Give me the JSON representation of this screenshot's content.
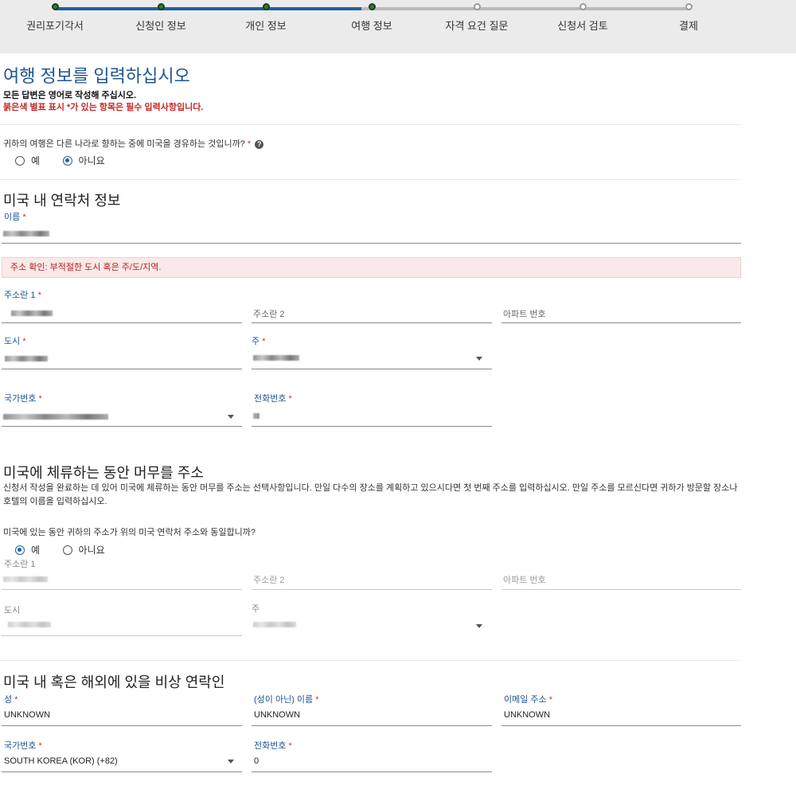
{
  "steps": [
    {
      "label": "권리포기각서",
      "status": "done"
    },
    {
      "label": "신청인 정보",
      "status": "done"
    },
    {
      "label": "개인 정보",
      "status": "done"
    },
    {
      "label": "여행 정보",
      "status": "current"
    },
    {
      "label": "자격 요건 질문",
      "status": "todo"
    },
    {
      "label": "신청서 검토",
      "status": "todo"
    },
    {
      "label": "결제",
      "status": "todo"
    }
  ],
  "page": {
    "title": "여행 정보를 입력하십시오",
    "note_english": "모든 답변은 영어로 작성해 주십시오.",
    "note_required": "붉은색 별표 표시 *가 있는 항목은 필수 입력사항입니다."
  },
  "transit": {
    "question": "귀하의 여행은 다른 나라로 향하는 중에 미국을 경유하는 것입니까?",
    "required_mark": "*",
    "options": [
      "예",
      "아니요"
    ],
    "selected": "아니요"
  },
  "us_contact": {
    "heading": "미국 내 연락처 정보",
    "name_label": "이름",
    "alert": "주소 확인: 부적절한 도시 혹은 주/도/지역.",
    "address1_label": "주소란 1",
    "address2_placeholder": "주소란 2",
    "apartment_placeholder": "아파트 번호",
    "city_label": "도시",
    "state_label": "주",
    "country_code_label": "국가번호",
    "phone_label": "전화번호",
    "required_mark": "*"
  },
  "us_address": {
    "heading": "미국에 체류하는 동안 머무를 주소",
    "description": "신청서 작성을 완료하는 데 있어 미국에 체류하는 동안 머무를 주소는 선택사항입니다. 만일 다수의 장소를 계획하고 있으시다면 첫 번째 주소를 입력하십시오. 만일 주소를 모르신다면 귀하가 방문할 장소나 호텔의 이름을 입력하십시오.",
    "same_question": "미국에 있는 동안 귀하의 주소가 위의 미국 연락처 주소와 동일합니까?",
    "options": [
      "예",
      "아니요"
    ],
    "selected": "예",
    "address1_label": "주소란 1",
    "address2_placeholder": "주소란 2",
    "apartment_placeholder": "아파트 번호",
    "city_label": "도시",
    "state_label": "주"
  },
  "emergency": {
    "heading": "미국 내 혹은 해외에 있을 비상 연락인",
    "last_name_label": "성",
    "last_name_value": "UNKNOWN",
    "first_name_label": "(성이 아닌) 이름",
    "first_name_value": "UNKNOWN",
    "email_label": "이메일 주소",
    "email_value": "UNKNOWN",
    "country_code_label": "국가번호",
    "country_code_value": "SOUTH KOREA (KOR) (+82)",
    "phone_label": "전화번호",
    "phone_value": "0",
    "required_mark": "*"
  },
  "icons": {
    "help": "question-circle-icon",
    "dropdown": "caret-down-icon"
  },
  "colors": {
    "accent": "#205493",
    "complete": "#2e7d32",
    "required": "#d32f2f",
    "alert_bg": "#fbe9e9"
  }
}
